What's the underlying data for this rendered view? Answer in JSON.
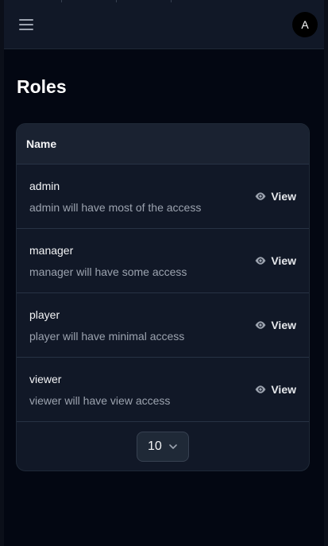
{
  "header": {
    "menu_icon": "hamburger-menu-icon",
    "avatar_initial": "A"
  },
  "page": {
    "title": "Roles"
  },
  "table": {
    "column_name": "Name",
    "rows": [
      {
        "name": "admin",
        "description": "admin will have most of the access",
        "action_label": "View",
        "action_icon": "eye-icon"
      },
      {
        "name": "manager",
        "description": "manager will have some access",
        "action_label": "View",
        "action_icon": "eye-icon"
      },
      {
        "name": "player",
        "description": "player will have minimal access",
        "action_label": "View",
        "action_icon": "eye-icon"
      },
      {
        "name": "viewer",
        "description": "viewer will have view access",
        "action_label": "View",
        "action_icon": "eye-icon"
      }
    ]
  },
  "pagination": {
    "per_page_value": "10"
  },
  "colors": {
    "background": "#030712",
    "surface": "#111827",
    "muted_text": "#9ca3af"
  }
}
